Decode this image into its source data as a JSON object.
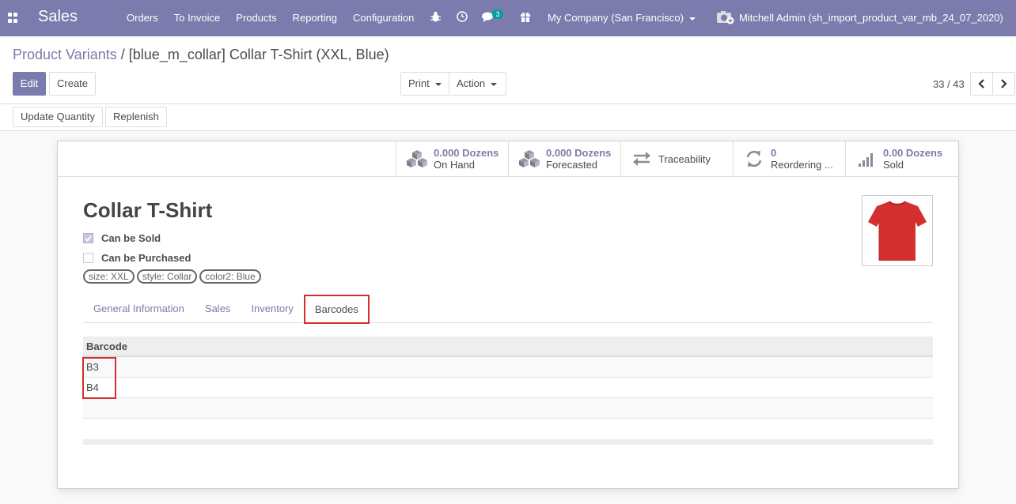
{
  "navbar": {
    "brand": "Sales",
    "menu": [
      "Orders",
      "To Invoice",
      "Products",
      "Reporting",
      "Configuration"
    ],
    "chat_badge": "3",
    "company": "My Company (San Francisco)",
    "user": "Mitchell Admin (sh_import_product_var_mb_24_07_2020)"
  },
  "breadcrumb": {
    "parent": "Product Variants",
    "separator": "/",
    "current": "[blue_m_collar] Collar T-Shirt (XXL, Blue)"
  },
  "toolbar": {
    "edit": "Edit",
    "create": "Create",
    "print": "Print",
    "action": "Action",
    "pager": "33 / 43",
    "update_quantity": "Update Quantity",
    "replenish": "Replenish"
  },
  "stats": [
    {
      "value": "0.000 Dozens",
      "label": "On Hand",
      "icon": "cubes-icon"
    },
    {
      "value": "0.000 Dozens",
      "label": "Forecasted",
      "icon": "cubes-icon"
    },
    {
      "value": "",
      "label": "Traceability",
      "icon": "exchange-icon"
    },
    {
      "value": "0",
      "label": "Reordering ...",
      "icon": "refresh-icon"
    },
    {
      "value": "0.00 Dozens",
      "label": "Sold",
      "icon": "signal-icon"
    }
  ],
  "product": {
    "name": "Collar T-Shirt",
    "can_be_sold": {
      "label": "Can be Sold",
      "checked": true
    },
    "can_be_purchased": {
      "label": "Can be Purchased",
      "checked": false
    },
    "tags": [
      "size: XXL",
      "style: Collar",
      "color2: Blue"
    ]
  },
  "tabs": [
    "General Information",
    "Sales",
    "Inventory",
    "Barcodes"
  ],
  "active_tab": "Barcodes",
  "barcodes": {
    "header": "Barcode",
    "rows": [
      "B3",
      "B4"
    ]
  },
  "colors": {
    "brand": "#7c7bad",
    "highlight": "#d32f2f",
    "badge": "#00a09d",
    "tshirt": "#d32f2f"
  }
}
